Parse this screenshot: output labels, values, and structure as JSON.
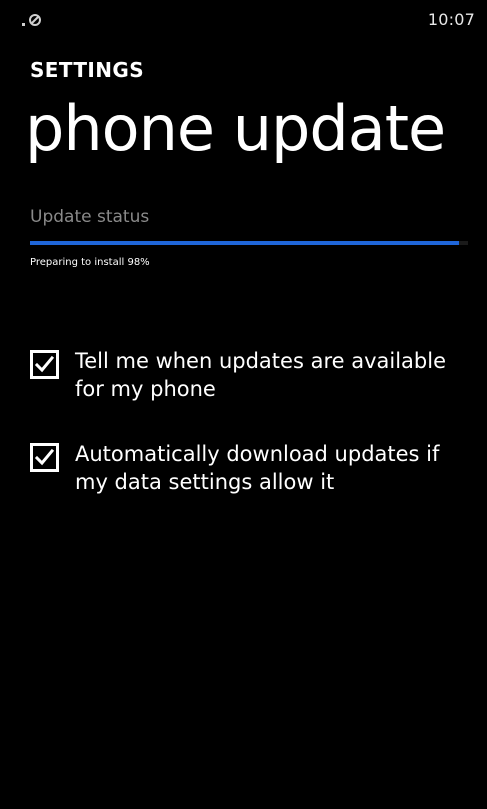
{
  "status_bar": {
    "clock": "10:07",
    "signal_icon": "no-signal-icon"
  },
  "header": {
    "app_title": "SETTINGS",
    "page_title": "phone update"
  },
  "update_status": {
    "label": "Update status",
    "progress_percent": 98,
    "progress_text": "Preparing to install 98%",
    "accent_color": "#1f66d9"
  },
  "options": [
    {
      "label": "Tell me when updates are available for my phone",
      "checked": true
    },
    {
      "label": "Automatically download updates if my data settings allow it",
      "checked": true
    }
  ]
}
